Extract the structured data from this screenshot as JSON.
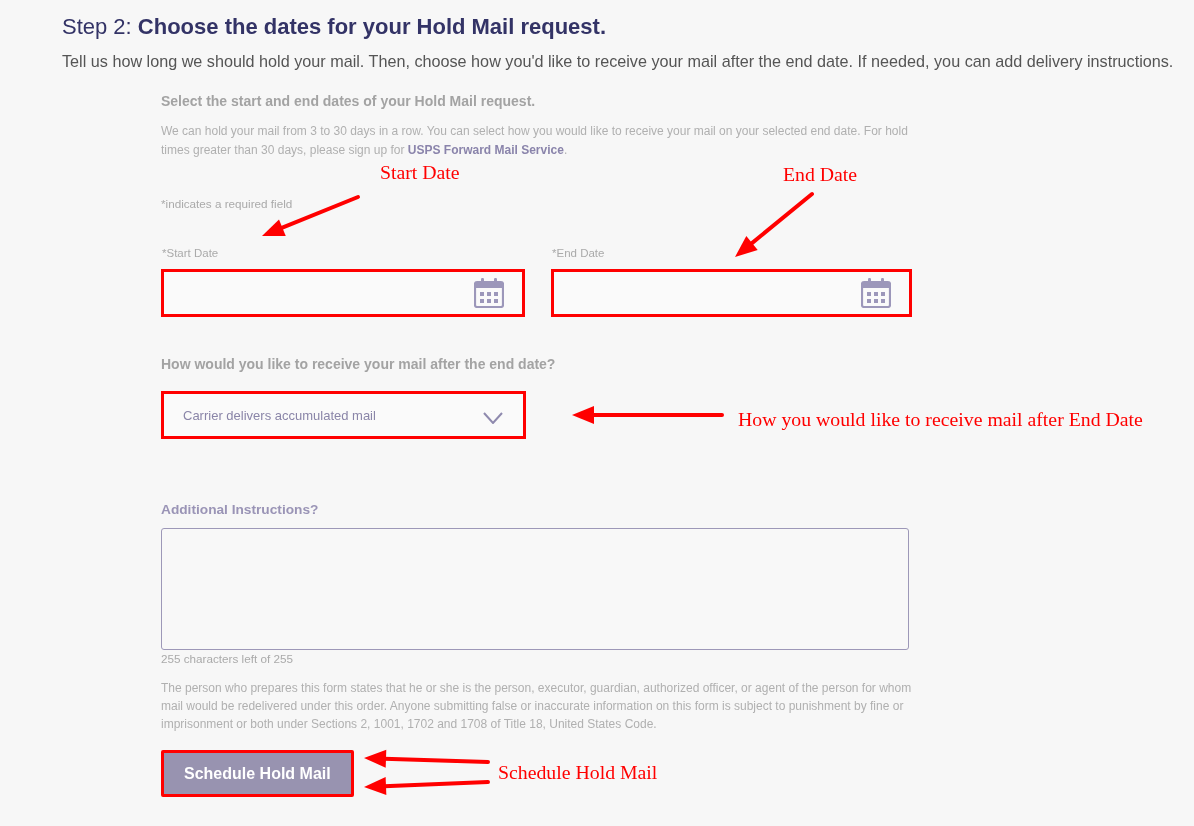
{
  "header": {
    "title": "Step 2: **Choose the dates for your Hold Mail request.**",
    "intro": "Tell us how long we should hold your mail. Then, choose how you'd like to receive your mail after the end date. If needed, you can add delivery instructions."
  },
  "dates_section": {
    "heading": "Select the start and end dates of your Hold Mail request.",
    "description": {
      "text": "We can hold your mail from 3 to 30 days in a row. You can select how you would like to receive your mail on your selected end date. For hold times greater than 30 days, please sign up for",
      "link": "USPS Forward Mail Service",
      "end": "."
    },
    "required_note": "*indicates a required field",
    "fields": [
      {
        "label": "*Start Date",
        "highlighted": true
      },
      {
        "label": "*End Date",
        "highlighted": true
      }
    ]
  },
  "delivery_section": {
    "question": "How would you like to receive your mail after the end date?",
    "dropdown": {
      "value": "Carrier delivers accumulated mail",
      "highlighted": true
    }
  },
  "instructions_section": {
    "label": "Additional Instructions?",
    "counter": "255 characters left of 255",
    "legal_text": "The person who prepares this form states that he or she is the person, executor, guardian, authorized officer, or agent of the person for whom mail would be redelivered under this order. Anyone submitting false or inaccurate information on this form is subject to punishment by fine or imprisonment or both under Sections 2, 1001, 1702 and 1708 of Title 18, United States Code."
  },
  "submit_button": {
    "label": "Schedule Hold Mail",
    "highlighted": true
  },
  "annotations": [
    "Start Date",
    "End Date",
    "How you would like to receive mail after End Date",
    "Schedule Hold Mail"
  ]
}
